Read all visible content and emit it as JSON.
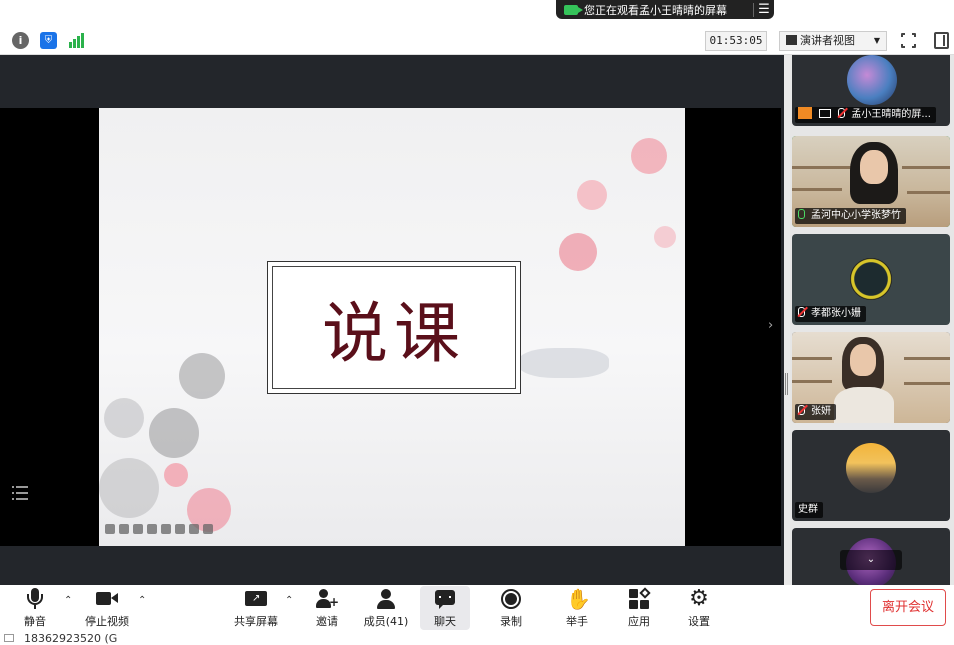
{
  "banner": {
    "text": "您正在观看孟小王晴晴的屏幕",
    "menu_icon": "menu-icon"
  },
  "toolbar": {
    "timer": "01:53:05",
    "view_label": "演讲者视图"
  },
  "slide": {
    "title": "说课"
  },
  "participants": [
    {
      "name": "孟小王晴晴的屏...",
      "status": "sharing"
    },
    {
      "name": "孟河中心小学张梦竹",
      "status": "speaking"
    },
    {
      "name": "孝都张小姗",
      "status": "muted"
    },
    {
      "name": "张妍",
      "status": "muted"
    },
    {
      "name": "史群",
      "status": ""
    },
    {
      "name": "",
      "status": ""
    }
  ],
  "bottom": {
    "mute": "静音",
    "stop_video": "停止视频",
    "share": "共享屏幕",
    "invite": "邀请",
    "members": "成员(41)",
    "chat": "聊天",
    "record": "录制",
    "raise_hand": "举手",
    "apps": "应用",
    "settings": "设置",
    "leave": "离开会议"
  },
  "status_bar": {
    "text": "18362923520 (G"
  },
  "colors": {
    "accent_green": "#2bb24c",
    "leave_red": "#e03030",
    "slide_title": "#5a0f1a"
  }
}
